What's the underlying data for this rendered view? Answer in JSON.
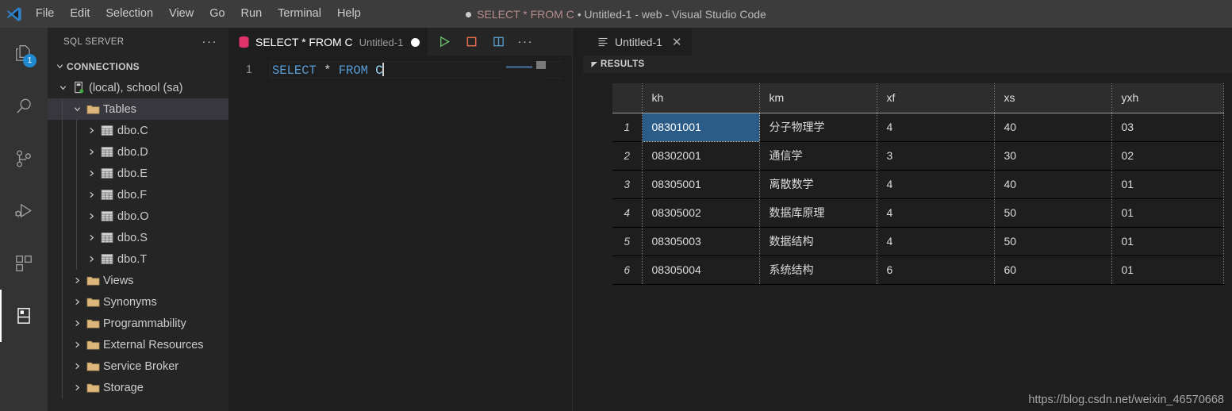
{
  "titlebar": {
    "dirty_indicator": "●",
    "title_sql": "SELECT * FROM C",
    "title_rest": " • Untitled-1 - web - Visual Studio Code",
    "menu": [
      {
        "label": "File"
      },
      {
        "label": "Edit"
      },
      {
        "label": "Selection"
      },
      {
        "label": "View"
      },
      {
        "label": "Go"
      },
      {
        "label": "Run"
      },
      {
        "label": "Terminal"
      },
      {
        "label": "Help"
      }
    ]
  },
  "activitybar": {
    "items": [
      {
        "name": "explorer-icon",
        "badge": "1"
      },
      {
        "name": "search-icon",
        "badge": ""
      },
      {
        "name": "source-control-icon",
        "badge": ""
      },
      {
        "name": "run-and-debug-icon",
        "badge": ""
      },
      {
        "name": "extensions-icon",
        "badge": ""
      },
      {
        "name": "sql-server-icon",
        "badge": ""
      }
    ]
  },
  "sidebar": {
    "title": "SQL SERVER",
    "more_label": "···",
    "section": "CONNECTIONS",
    "tree": [
      {
        "label": "(local), school (sa)",
        "icon": "server-icon",
        "indent": 0,
        "twisty": "down",
        "selected": false
      },
      {
        "label": "Tables",
        "icon": "folder-icon",
        "indent": 1,
        "twisty": "down",
        "selected": true
      },
      {
        "label": "dbo.C",
        "icon": "table-icon",
        "indent": 2,
        "twisty": "right",
        "selected": false
      },
      {
        "label": "dbo.D",
        "icon": "table-icon",
        "indent": 2,
        "twisty": "right",
        "selected": false
      },
      {
        "label": "dbo.E",
        "icon": "table-icon",
        "indent": 2,
        "twisty": "right",
        "selected": false
      },
      {
        "label": "dbo.F",
        "icon": "table-icon",
        "indent": 2,
        "twisty": "right",
        "selected": false
      },
      {
        "label": "dbo.O",
        "icon": "table-icon",
        "indent": 2,
        "twisty": "right",
        "selected": false
      },
      {
        "label": "dbo.S",
        "icon": "table-icon",
        "indent": 2,
        "twisty": "right",
        "selected": false
      },
      {
        "label": "dbo.T",
        "icon": "table-icon",
        "indent": 2,
        "twisty": "right",
        "selected": false
      },
      {
        "label": "Views",
        "icon": "folder-icon",
        "indent": 1,
        "twisty": "right",
        "selected": false
      },
      {
        "label": "Synonyms",
        "icon": "folder-icon",
        "indent": 1,
        "twisty": "right",
        "selected": false
      },
      {
        "label": "Programmability",
        "icon": "folder-icon",
        "indent": 1,
        "twisty": "right",
        "selected": false
      },
      {
        "label": "External Resources",
        "icon": "folder-icon",
        "indent": 1,
        "twisty": "right",
        "selected": false
      },
      {
        "label": "Service Broker",
        "icon": "folder-icon",
        "indent": 1,
        "twisty": "right",
        "selected": false
      },
      {
        "label": "Storage",
        "icon": "folder-icon",
        "indent": 1,
        "twisty": "right",
        "selected": false
      }
    ]
  },
  "editor": {
    "tab": {
      "name": "SELECT * FROM C",
      "description": "Untitled-1",
      "dirty": true,
      "db_icon": "database-icon"
    },
    "actions": [
      {
        "name": "run-query-button",
        "icon": "play-icon",
        "color": "#6ec36e"
      },
      {
        "name": "cancel-query-button",
        "icon": "stop-icon",
        "color": "#e06c4a"
      },
      {
        "name": "split-editor-button",
        "icon": "split-icon",
        "color": "#5a9ccc"
      },
      {
        "name": "more-actions-button",
        "icon": "ellipsis-icon",
        "color": "#cccccc"
      }
    ],
    "more_label": "···",
    "line_number": "1",
    "code": {
      "kw_select": "SELECT",
      "star": "*",
      "kw_from": "FROM",
      "table": "C"
    }
  },
  "results": {
    "tab": {
      "label": "Untitled-1",
      "icon": "results-icon",
      "close": "✕"
    },
    "section_label": "RESULTS",
    "caret": "◢",
    "columns": [
      "kh",
      "km",
      "xf",
      "xs",
      "yxh"
    ],
    "rows": [
      {
        "n": "1",
        "kh": "08301001",
        "km": "分子物理学",
        "xf": "4",
        "xs": "40",
        "yxh": "03"
      },
      {
        "n": "2",
        "kh": "08302001",
        "km": "通信学",
        "xf": "3",
        "xs": "30",
        "yxh": "02"
      },
      {
        "n": "3",
        "kh": "08305001",
        "km": "离散数学",
        "xf": "4",
        "xs": "40",
        "yxh": "01"
      },
      {
        "n": "4",
        "kh": "08305002",
        "km": "数据库原理",
        "xf": "4",
        "xs": "50",
        "yxh": "01"
      },
      {
        "n": "5",
        "kh": "08305003",
        "km": "数据结构",
        "xf": "4",
        "xs": "50",
        "yxh": "01"
      },
      {
        "n": "6",
        "kh": "08305004",
        "km": "系统结构",
        "xf": "6",
        "xs": "60",
        "yxh": "01"
      }
    ],
    "selected_cell": {
      "row": 0,
      "column": "kh"
    }
  },
  "watermark": "https://blog.csdn.net/weixin_46570668",
  "colors": {
    "titlebar_bg": "#3c3c3c",
    "activitybar_bg": "#333333",
    "sidebar_bg": "#252526",
    "editor_bg": "#1e1e1e",
    "selection_blue": "#2b5c87",
    "badge_blue": "#1f8ad2",
    "keyword_blue": "#569cd6",
    "identifier_blue": "#9cdcfe",
    "folder_tan": "#dcb67a",
    "run_green": "#6ec36e",
    "stop_orange": "#e06c4a"
  }
}
